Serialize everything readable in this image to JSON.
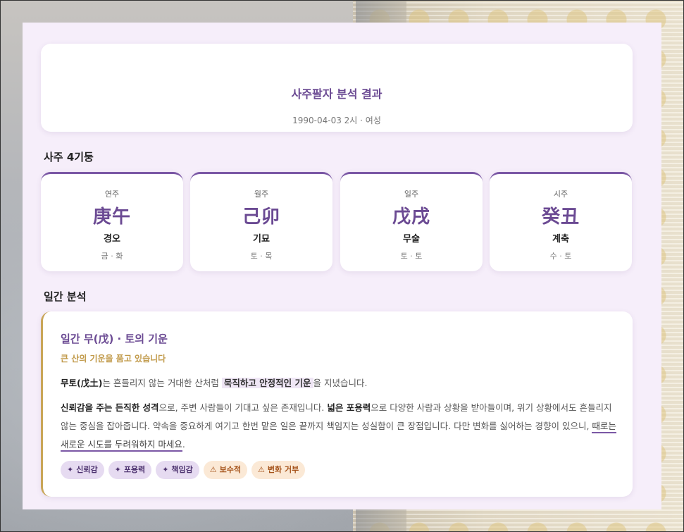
{
  "header": {
    "title": "사주팔자 분석 결과",
    "subtitle": "1990-04-03 2시 · 여성"
  },
  "pillars_section": {
    "title": "사주 4기둥",
    "items": [
      {
        "label": "연주",
        "hanja": "庚午",
        "hangul": "경오",
        "elements": "금 · 화"
      },
      {
        "label": "월주",
        "hanja": "己卯",
        "hangul": "기묘",
        "elements": "토 · 목"
      },
      {
        "label": "일주",
        "hanja": "戊戌",
        "hangul": "무술",
        "elements": "토 · 토"
      },
      {
        "label": "시주",
        "hanja": "癸丑",
        "hangul": "계축",
        "elements": "수 · 토"
      }
    ]
  },
  "analysis_section": {
    "title": "일간 분석",
    "card_title": "일간 무(戊) · 토의 기운",
    "card_subtitle": "큰 산의 기운을 품고 있습니다",
    "p1": {
      "s1": "무토(戊土)",
      "s2": "는 흔들리지 않는 거대한 산처럼 ",
      "s3": "묵직하고 안정적인 기운",
      "s4": "을 지녔습니다."
    },
    "p2": {
      "s1": "신뢰감을 주는 든직한 성격",
      "s2": "으로, 주변 사람들이 기대고 싶은 존재입니다. ",
      "s3": "넓은 포용력",
      "s4": "으로 다양한 사람과 상황을 받아들이며, 위기 상황에서도 흔들리지 않는 중심을 잡아줍니다. 약속을 중요하게 여기고 한번 맡은 일은 끝까지 책임지는 성실함이 큰 장점입니다. 다만 변화를 싫어하는 경향이 있으니, ",
      "s5": "때로는 새로운 시도를 두려워하지 마세요",
      "s6": "."
    },
    "tags": [
      {
        "icon": "✦",
        "label": "신뢰감",
        "type": "positive"
      },
      {
        "icon": "✦",
        "label": "포용력",
        "type": "positive"
      },
      {
        "icon": "✦",
        "label": "책임감",
        "type": "positive"
      },
      {
        "icon": "⚠",
        "label": "보수적",
        "type": "negative"
      },
      {
        "icon": "⚠",
        "label": "변화 거부",
        "type": "negative"
      }
    ]
  },
  "colors": {
    "accent": "#6b4a93",
    "gold": "#c19a4a",
    "panel_bg": "#f6eefa"
  }
}
